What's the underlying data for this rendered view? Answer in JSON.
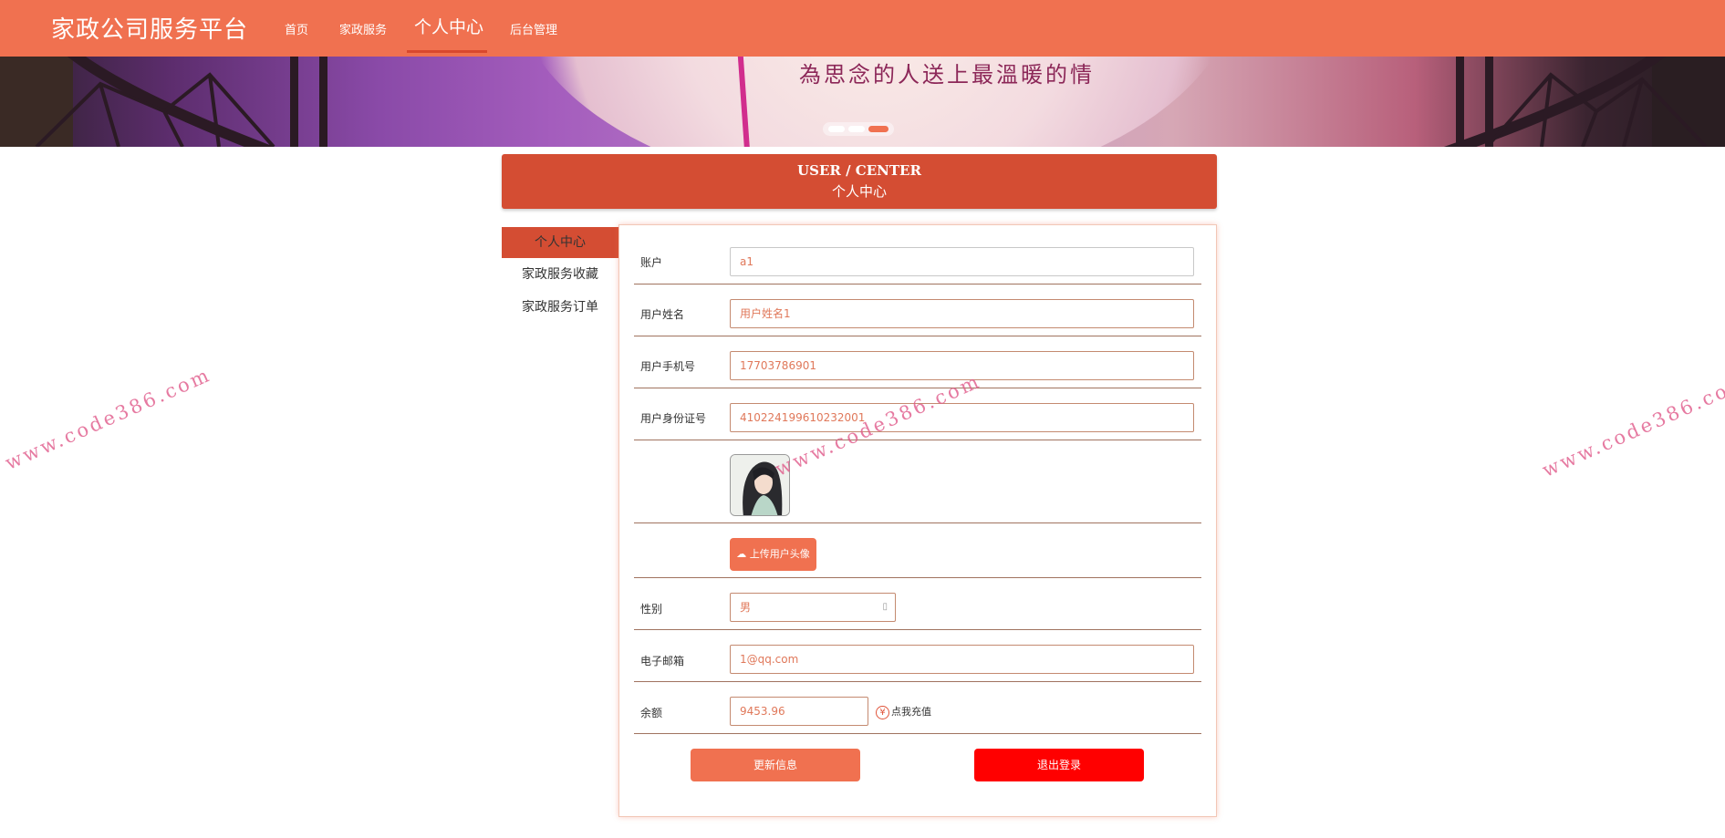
{
  "header": {
    "brand": "家政公司服务平台",
    "nav": [
      {
        "label": "首页"
      },
      {
        "label": "家政服务"
      },
      {
        "label": "个人中心"
      },
      {
        "label": "后台管理"
      }
    ],
    "active_nav": "个人中心",
    "accent_color": "#f07150"
  },
  "banner": {
    "text": "為思念的人送上最溫暖的情",
    "slides": 3,
    "active_slide": 3
  },
  "title": {
    "en": "USER / CENTER",
    "cn": "个人中心"
  },
  "sidebar": {
    "items": [
      {
        "label": "个人中心"
      },
      {
        "label": "家政服务收藏"
      },
      {
        "label": "家政服务订单"
      }
    ],
    "active": "个人中心"
  },
  "form": {
    "account": {
      "label": "账户",
      "value": "a1"
    },
    "name": {
      "label": "用户姓名",
      "value": "用户姓名1"
    },
    "phone": {
      "label": "用户手机号",
      "value": "17703786901"
    },
    "idcard": {
      "label": "用户身份证号",
      "value": "410224199610232001"
    },
    "upload_label": "上传用户头像",
    "gender": {
      "label": "性别",
      "value": "男"
    },
    "email": {
      "label": "电子邮箱",
      "value": "1@qq.com"
    },
    "balance": {
      "label": "余额",
      "value": "9453.96"
    },
    "recharge_label": "点我充值",
    "update_label": "更新信息",
    "logout_label": "退出登录",
    "logout_color": "#ff0000"
  },
  "watermark": "www.code386.com"
}
